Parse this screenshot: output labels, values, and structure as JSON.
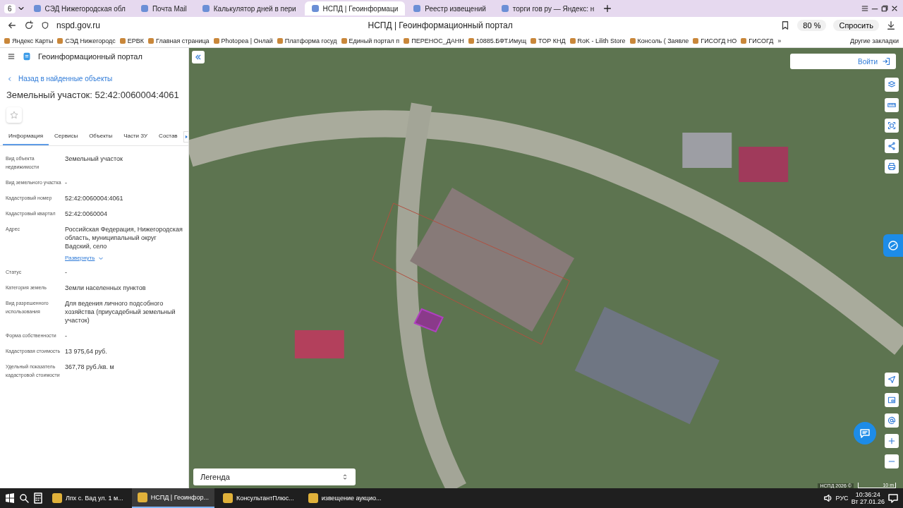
{
  "browser": {
    "tab_count": "6",
    "tabs": [
      {
        "title": "СЭД Нижегородская обл",
        "selected": false
      },
      {
        "title": "Почта Mail",
        "selected": false
      },
      {
        "title": "Калькулятор дней в пери",
        "selected": false
      },
      {
        "title": "НСПД | Геоинформаци",
        "selected": true
      },
      {
        "title": "Реестр извещений",
        "selected": false
      },
      {
        "title": "торги гов ру — Яндекс: н",
        "selected": false
      }
    ],
    "url": "nspd.gov.ru",
    "page_title": "НСПД | Геоинформационный портал",
    "zoom": "80 %",
    "ask": "Спросить",
    "bookmarks": [
      "Яндекс Карты",
      "СЭД Нижегородс",
      "ЕРВК",
      "Главная страница",
      "Photopea | Онлай",
      "Платформа госуд",
      "Единый портал п",
      "ПЕРЕНОС_ДАНН",
      "10885.БФТ.Имущ",
      "ТОР КНД",
      "RoK - Lilith Store",
      "Консоль ( Заявле",
      "ГИСОГД НО",
      "ГИСОГД"
    ],
    "more": "»",
    "other_bookmarks": "Другие закладки"
  },
  "portal": {
    "title": "Геоинформационный портал",
    "back_link": "Назад в найденные объекты",
    "heading": "Земельный участок: 52:42:0060004:4061",
    "tabs": [
      {
        "label": "Информация",
        "selected": true
      },
      {
        "label": "Сервисы",
        "selected": false
      },
      {
        "label": "Объекты",
        "selected": false
      },
      {
        "label": "Части ЗУ",
        "selected": false
      },
      {
        "label": "Состав",
        "selected": false
      }
    ],
    "fields": [
      {
        "label": "Вид объекта недвижимости",
        "value": "Земельный участок"
      },
      {
        "label": "Вид земельного участка",
        "value": "-"
      },
      {
        "label": "Кадастровый номер",
        "value": "52:42:0060004:4061"
      },
      {
        "label": "Кадастровый квартал",
        "value": "52:42:0060004"
      },
      {
        "label": "Адрес",
        "value": "Российская Федерация, Нижегородская область, муниципальный округ Вадский, село",
        "expand": "Развернуть"
      },
      {
        "label": "Статус",
        "value": "-"
      },
      {
        "label": "Категория земель",
        "value": "Земли населенных пунктов"
      },
      {
        "label": "Вид разрешенного использования",
        "value": "Для ведения личного подсобного хозяйства (приусадебный земельный участок)"
      },
      {
        "label": "Форма собственности",
        "value": "-"
      },
      {
        "label": "Кадастровая стоимость",
        "value": "13 975,64 руб."
      },
      {
        "label": "Удельный показатель кадастровой стоимости",
        "value": "367,78 руб./кв. м"
      }
    ]
  },
  "map": {
    "login": "Войти",
    "legend": "Легенда",
    "attribution": "НСПД 2026 ©",
    "scale": "10 m"
  },
  "taskbar": {
    "apps": [
      {
        "label": "Лпх  с. Вад ул. 1 м...",
        "selected": false
      },
      {
        "label": "НСПД | Геоинфор...",
        "selected": true
      },
      {
        "label": "КонсультантПлюс...",
        "selected": false
      },
      {
        "label": "извещение аукцио...",
        "selected": false
      }
    ],
    "language": "РУС",
    "time": "10:36:24",
    "date": "Вт 27.01.26"
  }
}
